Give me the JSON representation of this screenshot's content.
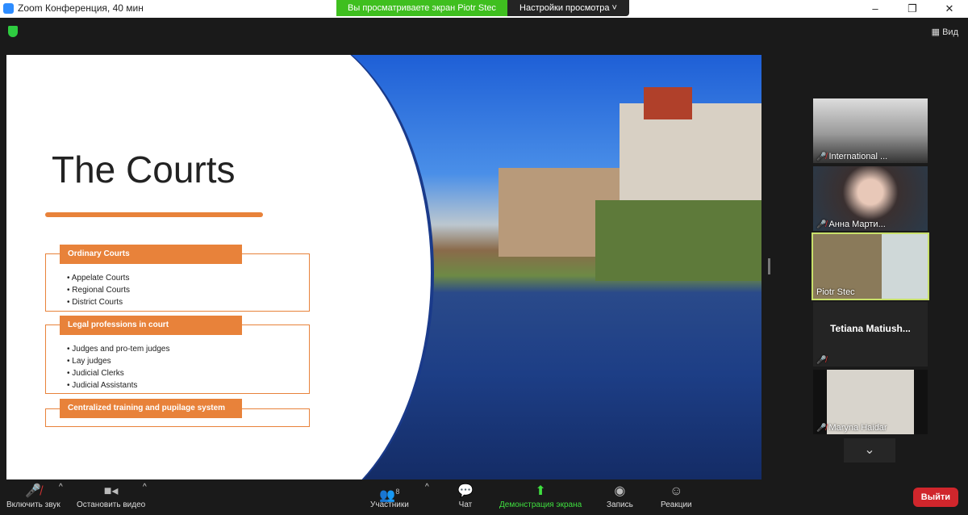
{
  "window": {
    "title": "Zoom Конференция, 40 мин",
    "viewing_banner": "Вы просматриваете экран Piotr Stec",
    "view_options": "Настройки просмотра",
    "view_button": "Вид"
  },
  "slide": {
    "title": "The Courts",
    "sections": [
      {
        "header": "Ordinary Courts",
        "items": [
          "Appelate Courts",
          "Regional Courts",
          "District Courts"
        ]
      },
      {
        "header": "Legal professions in court",
        "items": [
          "Judges and pro-tem judges",
          "Lay judges",
          "Judicial Clerks",
          "Judicial Assistants"
        ]
      },
      {
        "header": "Centralized training and pupilage system",
        "items": []
      }
    ]
  },
  "participants": [
    {
      "name": "International ...",
      "muted": true
    },
    {
      "name": "Анна Марти...",
      "muted": true
    },
    {
      "name": "Piotr Stec",
      "muted": false,
      "active": true
    },
    {
      "name": "Tetiana  Matiush...",
      "muted": true,
      "video": false
    },
    {
      "name": "Maryna Haidar",
      "muted": true
    }
  ],
  "toolbar": {
    "unmute": "Включить звук",
    "stop_video": "Остановить видео",
    "participants": "Участники",
    "participants_count": "8",
    "chat": "Чат",
    "share": "Демонстрация экрана",
    "record": "Запись",
    "reactions": "Реакции",
    "leave": "Выйти"
  }
}
